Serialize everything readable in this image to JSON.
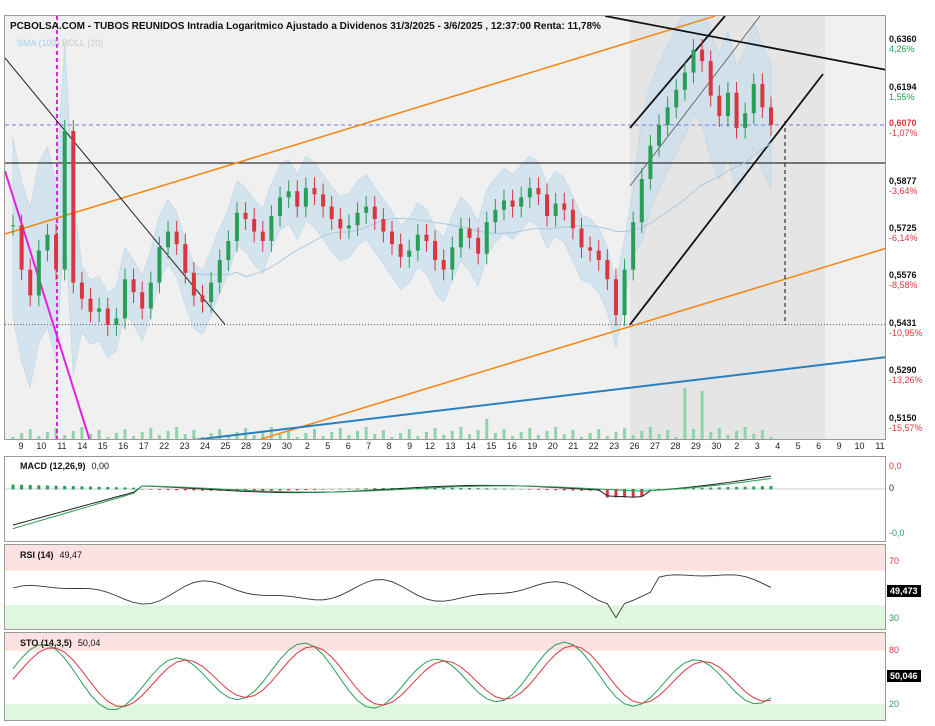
{
  "header": {
    "title": "PCBOLSA.COM - TUBOS REUNIDOS Intradia Logaritmico Ajustado a Dividenos 31/3/2025 - 3/6/2025 , 12:37:00 Renta: 11,78%",
    "legend_sma": "SMA (100)",
    "legend_boll": "BOLL (20)"
  },
  "colors": {
    "up": "#2a9d57",
    "down": "#d9363e",
    "channel_orange": "#f28a1a",
    "trend_blue": "#2a7fc0",
    "magenta": "#e61ee6",
    "boll_fill": "#c9dfee",
    "volume": "#8fd4a8",
    "macd_area": "#9be89b",
    "rsi_band_high": "#fde2e2",
    "rsi_band_low": "#dff7df"
  },
  "chart_data": [
    {
      "type": "candlestick",
      "title": "TUBOS REUNIDOS",
      "scale": "log",
      "ylim": [
        0.509,
        0.645
      ],
      "price_axis": [
        {
          "value": "0,6360",
          "pct": "4,26%",
          "dir": "up"
        },
        {
          "value": "0,6194",
          "pct": "1,55%",
          "dir": "up"
        },
        {
          "value": "0,6070",
          "pct": "-1,07%",
          "dir": "down",
          "current": true
        },
        {
          "value": "0,5877",
          "pct": "-3,64%",
          "dir": "down"
        },
        {
          "value": "0,5725",
          "pct": "-6,14%",
          "dir": "down"
        },
        {
          "value": "0,5576",
          "pct": "-8,58%",
          "dir": "down"
        },
        {
          "value": "0,5431",
          "pct": "-10,95%",
          "dir": "down"
        },
        {
          "value": "0,5290",
          "pct": "-13,26%",
          "dir": "down"
        },
        {
          "value": "0,5150",
          "pct": "-15,57%",
          "dir": "down"
        }
      ],
      "x_labels": [
        "9",
        "10",
        "11",
        "14",
        "15",
        "16",
        "17",
        "22",
        "23",
        "24",
        "25",
        "28",
        "29",
        "30",
        "2",
        "5",
        "6",
        "7",
        "8",
        "9",
        "12",
        "13",
        "14",
        "15",
        "16",
        "19",
        "20",
        "21",
        "22",
        "23",
        "26",
        "27",
        "28",
        "29",
        "30",
        "2",
        "3",
        "4",
        "5",
        "6",
        "9",
        "10",
        "11"
      ],
      "last_price": 0.607,
      "close_series": [
        0.574,
        0.56,
        0.552,
        0.566,
        0.571,
        0.56,
        0.605,
        0.556,
        0.551,
        0.547,
        0.548,
        0.543,
        0.545,
        0.557,
        0.553,
        0.548,
        0.556,
        0.567,
        0.572,
        0.568,
        0.559,
        0.552,
        0.55,
        0.556,
        0.563,
        0.569,
        0.578,
        0.576,
        0.572,
        0.569,
        0.577,
        0.583,
        0.585,
        0.58,
        0.586,
        0.584,
        0.58,
        0.576,
        0.573,
        0.574,
        0.578,
        0.58,
        0.576,
        0.572,
        0.568,
        0.564,
        0.566,
        0.571,
        0.569,
        0.563,
        0.56,
        0.567,
        0.573,
        0.57,
        0.565,
        0.575,
        0.579,
        0.582,
        0.58,
        0.583,
        0.586,
        0.584,
        0.577,
        0.581,
        0.579,
        0.573,
        0.567,
        0.566,
        0.563,
        0.557,
        0.546,
        0.56,
        0.575,
        0.589,
        0.6,
        0.607,
        0.613,
        0.619,
        0.625,
        0.633,
        0.629,
        0.617,
        0.61,
        0.618,
        0.606,
        0.611,
        0.621,
        0.613,
        0.607
      ]
    },
    {
      "type": "line",
      "title": "MACD (12,26,9)",
      "value": "0,00",
      "yticks": [
        "0,0",
        "0",
        "-0,0"
      ]
    },
    {
      "type": "line",
      "title": "RSI (14)",
      "value": "49,47",
      "last_tag": "49,473",
      "yticks": [
        "70",
        "30"
      ],
      "ylim": [
        0,
        100
      ]
    },
    {
      "type": "line",
      "title": "STO (14,3,5)",
      "value": "50,04",
      "last_tag": "50,046",
      "yticks": [
        "80",
        "20"
      ],
      "ylim": [
        0,
        100
      ]
    }
  ]
}
